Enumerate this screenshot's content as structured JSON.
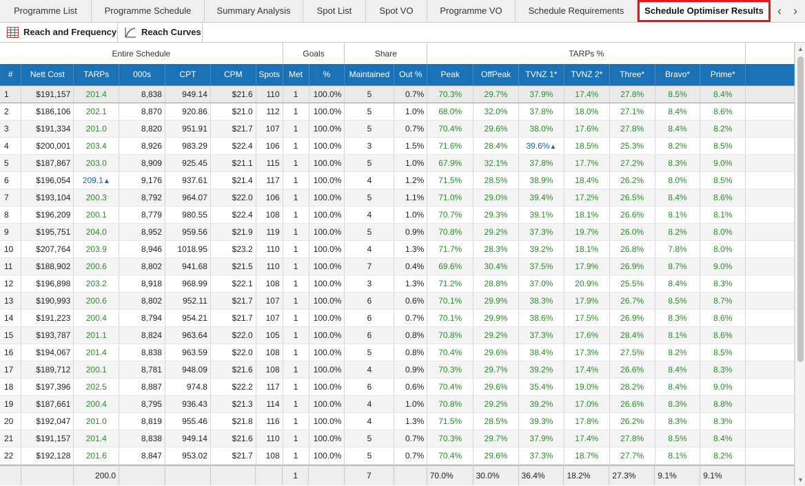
{
  "tabs": [
    {
      "label": "Programme List"
    },
    {
      "label": "Programme Schedule"
    },
    {
      "label": "Summary Analysis"
    },
    {
      "label": "Spot List"
    },
    {
      "label": "Spot VO"
    },
    {
      "label": "Programme VO"
    },
    {
      "label": "Schedule Requirements"
    },
    {
      "label": "Schedule Optimiser Results",
      "active": true
    }
  ],
  "tab_nav": {
    "prev": "‹",
    "next": "›"
  },
  "toolbar": {
    "reach_frequency_label": "Reach and Frequency",
    "reach_curves_label": "Reach Curves"
  },
  "group_headers": {
    "entire_schedule": "Entire Schedule",
    "goals": "Goals",
    "share": "Share",
    "tarps_pct": "TARPs %"
  },
  "columns": [
    "#",
    "Nett Cost",
    "TARPs",
    "000s",
    "CPT",
    "CPM",
    "Spots",
    "Met",
    "%",
    "Maintained",
    "Out %",
    "Peak",
    "OffPeak",
    "TVNZ 1*",
    "TVNZ 2*",
    "Three*",
    "Bravo*",
    "Prime*"
  ],
  "rows": [
    [
      "1",
      "$191,157",
      "201.4",
      "8,838",
      "949.14",
      "$21.6",
      "110",
      "1",
      "100.0%",
      "5",
      "0.7%",
      "70.3%",
      "29.7%",
      "37.9%",
      "17.4%",
      "27.8%",
      "8.5%",
      "8.4%"
    ],
    [
      "2",
      "$186,106",
      "202.1",
      "8,870",
      "920.86",
      "$21.0",
      "112",
      "1",
      "100.0%",
      "5",
      "1.0%",
      "68.0%",
      "32.0%",
      "37.8%",
      "18.0%",
      "27.1%",
      "8.4%",
      "8.6%"
    ],
    [
      "3",
      "$191,334",
      "201.0",
      "8,820",
      "951.91",
      "$21.7",
      "107",
      "1",
      "100.0%",
      "5",
      "0.7%",
      "70.4%",
      "29.6%",
      "38.0%",
      "17.6%",
      "27.8%",
      "8.4%",
      "8.2%"
    ],
    [
      "4",
      "$200,001",
      "203.4",
      "8,926",
      "983.29",
      "$22.4",
      "106",
      "1",
      "100.0%",
      "3",
      "1.5%",
      "71.6%",
      "28.4%",
      "39.6%",
      "18.5%",
      "25.3%",
      "8.2%",
      "8.5%"
    ],
    [
      "5",
      "$187,867",
      "203.0",
      "8,909",
      "925.45",
      "$21.1",
      "115",
      "1",
      "100.0%",
      "5",
      "1.0%",
      "67.9%",
      "32.1%",
      "37.8%",
      "17.7%",
      "27.2%",
      "8.3%",
      "9.0%"
    ],
    [
      "6",
      "$196,054",
      "209.1",
      "9,176",
      "937.61",
      "$21.4",
      "117",
      "1",
      "100.0%",
      "4",
      "1.2%",
      "71.5%",
      "28.5%",
      "38.9%",
      "18.4%",
      "26.2%",
      "8.0%",
      "8.5%"
    ],
    [
      "7",
      "$193,104",
      "200.3",
      "8,792",
      "964.07",
      "$22.0",
      "106",
      "1",
      "100.0%",
      "5",
      "1.1%",
      "71.0%",
      "29.0%",
      "39.4%",
      "17.2%",
      "26.5%",
      "8.4%",
      "8.6%"
    ],
    [
      "8",
      "$196,209",
      "200.1",
      "8,779",
      "980.55",
      "$22.4",
      "108",
      "1",
      "100.0%",
      "4",
      "1.0%",
      "70.7%",
      "29.3%",
      "39.1%",
      "18.1%",
      "26.6%",
      "8.1%",
      "8.1%"
    ],
    [
      "9",
      "$195,751",
      "204.0",
      "8,952",
      "959.56",
      "$21.9",
      "119",
      "1",
      "100.0%",
      "5",
      "0.9%",
      "70.8%",
      "29.2%",
      "37.3%",
      "19.7%",
      "26.0%",
      "8.2%",
      "8.0%"
    ],
    [
      "10",
      "$207,764",
      "203.9",
      "8,946",
      "1018.95",
      "$23.2",
      "110",
      "1",
      "100.0%",
      "4",
      "1.3%",
      "71.7%",
      "28.3%",
      "39.2%",
      "18.1%",
      "26.8%",
      "7.8%",
      "8.0%"
    ],
    [
      "11",
      "$188,902",
      "200.6",
      "8,802",
      "941.68",
      "$21.5",
      "110",
      "1",
      "100.0%",
      "7",
      "0.4%",
      "69.6%",
      "30.4%",
      "37.5%",
      "17.9%",
      "26.9%",
      "8.7%",
      "9.0%"
    ],
    [
      "12",
      "$196,898",
      "203.2",
      "8,918",
      "968.99",
      "$22.1",
      "108",
      "1",
      "100.0%",
      "3",
      "1.3%",
      "71.2%",
      "28.8%",
      "37.0%",
      "20.9%",
      "25.5%",
      "8.4%",
      "8.3%"
    ],
    [
      "13",
      "$190,993",
      "200.6",
      "8,802",
      "952.11",
      "$21.7",
      "107",
      "1",
      "100.0%",
      "6",
      "0.6%",
      "70.1%",
      "29.9%",
      "38.3%",
      "17.9%",
      "26.7%",
      "8.5%",
      "8.7%"
    ],
    [
      "14",
      "$191,223",
      "200.4",
      "8,794",
      "954.21",
      "$21.7",
      "107",
      "1",
      "100.0%",
      "6",
      "0.7%",
      "70.1%",
      "29.9%",
      "38.6%",
      "17.5%",
      "26.9%",
      "8.3%",
      "8.6%"
    ],
    [
      "15",
      "$193,787",
      "201.1",
      "8,824",
      "963.64",
      "$22.0",
      "105",
      "1",
      "100.0%",
      "6",
      "0.8%",
      "70.8%",
      "29.2%",
      "37.3%",
      "17.6%",
      "28.4%",
      "8.1%",
      "8.6%"
    ],
    [
      "16",
      "$194,067",
      "201.4",
      "8,838",
      "963.59",
      "$22.0",
      "108",
      "1",
      "100.0%",
      "5",
      "0.8%",
      "70.4%",
      "29.6%",
      "38.4%",
      "17.3%",
      "27.5%",
      "8.2%",
      "8.5%"
    ],
    [
      "17",
      "$189,712",
      "200.1",
      "8,781",
      "948.09",
      "$21.6",
      "108",
      "1",
      "100.0%",
      "4",
      "0.9%",
      "70.3%",
      "29.7%",
      "39.2%",
      "17.4%",
      "26.6%",
      "8.4%",
      "8.3%"
    ],
    [
      "18",
      "$197,396",
      "202.5",
      "8,887",
      "974.8",
      "$22.2",
      "117",
      "1",
      "100.0%",
      "6",
      "0.6%",
      "70.4%",
      "29.6%",
      "35.4%",
      "19.0%",
      "28.2%",
      "8.4%",
      "9.0%"
    ],
    [
      "19",
      "$187,661",
      "200.4",
      "8,795",
      "936.43",
      "$21.3",
      "114",
      "1",
      "100.0%",
      "4",
      "1.0%",
      "70.8%",
      "29.2%",
      "39.2%",
      "17.0%",
      "26.6%",
      "8.3%",
      "8.8%"
    ],
    [
      "20",
      "$192,047",
      "201.0",
      "8,819",
      "955.46",
      "$21.8",
      "116",
      "1",
      "100.0%",
      "4",
      "1.3%",
      "71.5%",
      "28.5%",
      "39.3%",
      "17.8%",
      "26.2%",
      "8.3%",
      "8.3%"
    ],
    [
      "21",
      "$191,157",
      "201.4",
      "8,838",
      "949.14",
      "$21.6",
      "110",
      "1",
      "100.0%",
      "5",
      "0.7%",
      "70.3%",
      "29.7%",
      "37.9%",
      "17.4%",
      "27.8%",
      "8.5%",
      "8.4%"
    ],
    [
      "22",
      "$192,128",
      "201.6",
      "8,847",
      "953.02",
      "$21.7",
      "108",
      "1",
      "100.0%",
      "5",
      "0.7%",
      "70.4%",
      "29.6%",
      "37.3%",
      "18.7%",
      "27.7%",
      "8.1%",
      "8.2%"
    ]
  ],
  "best_markers": {
    "tarps_row": 6,
    "tvnz1_row": 4,
    "arrow": "▲"
  },
  "footer": [
    "",
    "",
    "200.0",
    "",
    "",
    "",
    "",
    "1",
    "",
    "7",
    "",
    "70.0%",
    "30.0%",
    "36.4%",
    "18.2%",
    "27.3%",
    "9.1%",
    "9.1%"
  ],
  "colors": {
    "header_blue": "#1a71b5",
    "value_green": "#2e8a2e",
    "best_blue": "#1a5fc4",
    "active_tab_border": "#e8131c"
  }
}
